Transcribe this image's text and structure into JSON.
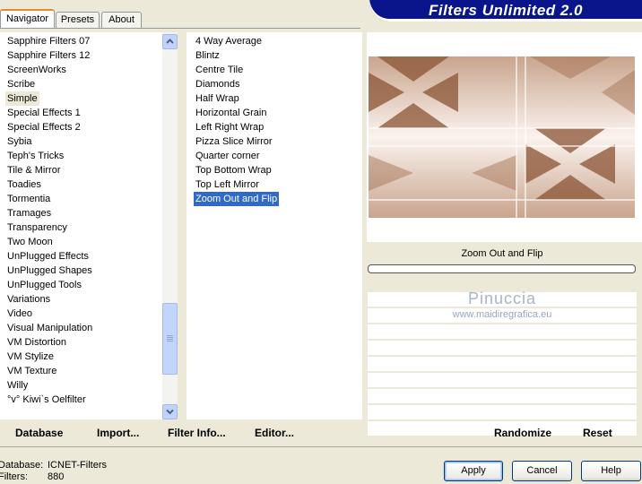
{
  "tabs": [
    {
      "label": "Navigator",
      "active": true
    },
    {
      "label": "Presets",
      "active": false
    },
    {
      "label": "About",
      "active": false
    }
  ],
  "banner_title": "Filters Unlimited 2.0",
  "categories": [
    "Sapphire Filters 07",
    "Sapphire Filters 12",
    "ScreenWorks",
    "Scribe",
    "Simple",
    "Special Effects 1",
    "Special Effects 2",
    "Sybia",
    "Teph's Tricks",
    "Tile & Mirror",
    "Toadies",
    "Tormentia",
    "Tramages",
    "Transparency",
    "Two Moon",
    "UnPlugged Effects",
    "UnPlugged Shapes",
    "UnPlugged Tools",
    "Variations",
    "Video",
    "Visual Manipulation",
    "VM Distortion",
    "VM Stylize",
    "VM Texture",
    "Willy",
    "°v° Kiwi`s Oelfilter"
  ],
  "selected_category": "Simple",
  "filters": [
    "4 Way Average",
    "Blintz",
    "Centre Tile",
    "Diamonds",
    "Half Wrap",
    "Horizontal Grain",
    "Left Right Wrap",
    "Pizza Slice Mirror",
    "Quarter corner",
    "Top Bottom Wrap",
    "Top Left Mirror",
    "Zoom Out and Flip"
  ],
  "selected_filter": "Zoom Out and Flip",
  "scrollbar": {
    "position": 0.9
  },
  "preview": {
    "filter_label": "Zoom Out and Flip",
    "progress": 0
  },
  "watermark": {
    "name": "Pinuccia",
    "url": "www.maidiregrafica.eu"
  },
  "links": {
    "database": "Database",
    "import": "Import...",
    "filter_info": "Filter Info...",
    "editor": "Editor...",
    "randomize": "Randomize",
    "reset": "Reset"
  },
  "status": {
    "database_label": "Database:",
    "database_value": "ICNET-Filters",
    "filters_label": "Filters:",
    "filters_value": "880"
  },
  "buttons": {
    "apply": "Apply",
    "cancel": "Cancel",
    "help": "Help"
  },
  "colors": {
    "banner": "#0A158C",
    "selection": "#316AC5",
    "preview_dark": "#8B5434",
    "preview_light": "#F4E6DC",
    "window_bg": "#ECE9D8"
  }
}
